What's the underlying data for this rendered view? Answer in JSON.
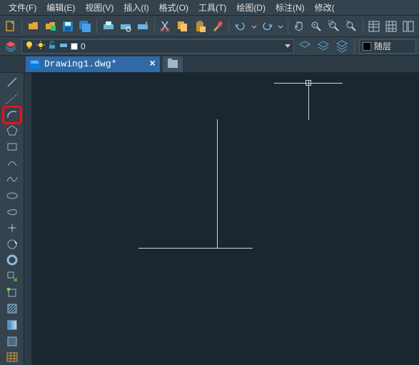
{
  "menu": {
    "file": "文件(F)",
    "edit": "编辑(E)",
    "view": "视图(V)",
    "insert": "插入(I)",
    "format": "格式(O)",
    "tools": "工具(T)",
    "draw": "绘图(D)",
    "dimension": "标注(N)",
    "modify": "修改("
  },
  "layer": {
    "current": "0",
    "bylayer_label": "随层"
  },
  "doc": {
    "filename": "Drawing1.dwg*"
  },
  "icons": {
    "new": "new-doc",
    "open": "open-folder",
    "save": "save-disk"
  },
  "toolpalette": {
    "items": [
      "line",
      "polyline",
      "arc",
      "polygon",
      "rectangle",
      "spline1",
      "spline2",
      "ellipse",
      "revision-cloud",
      "point",
      "circle-c",
      "circle-2p",
      "block",
      "hatch",
      "region",
      "gradient",
      "table",
      "grid"
    ]
  }
}
